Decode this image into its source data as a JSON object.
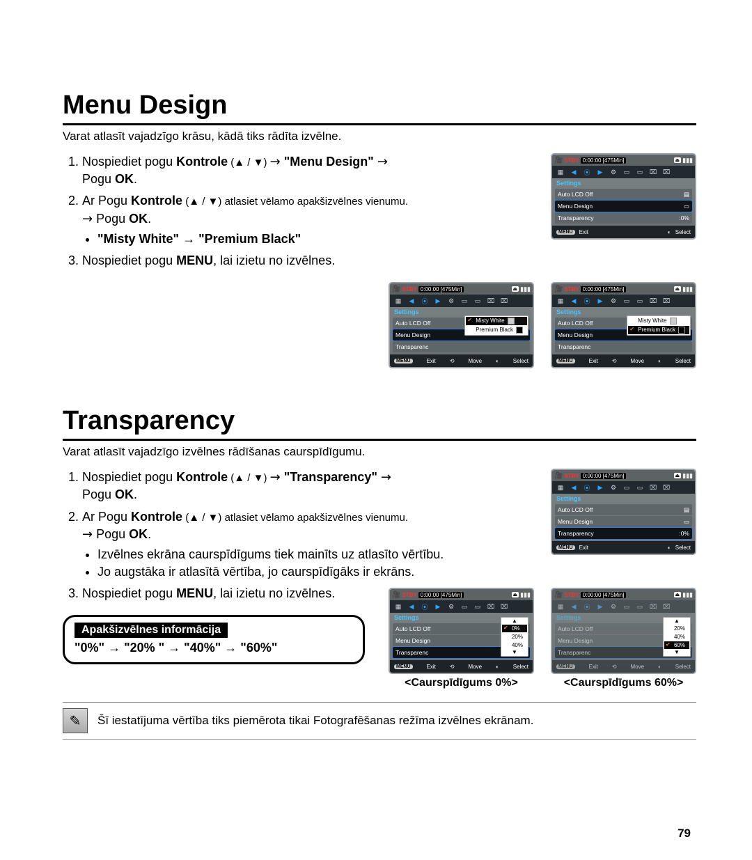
{
  "page_number": "79",
  "section1": {
    "title": "Menu Design",
    "intro": "Varat atlasīt vajadzīgo krāsu, kādā tiks rādīta izvēlne.",
    "step1_a": "Nospiediet pogu ",
    "step1_b": "Kontrole",
    "step1_c": " (▲ / ▼) ",
    "step1_arrow": "→",
    "step1_d": " \"Menu Design\" ",
    "step1_e": "Pogu ",
    "step1_f": "OK",
    "step2_a": "Ar Pogu ",
    "step2_b": "Kontrole",
    "step2_c": "  (▲ / ▼) atlasiet vēlamo apakšizvēlnes vienumu. ",
    "step2_arrow": "→",
    "step2_d": " Pogu ",
    "step2_e": "OK",
    "step2_bullet": "\"Misty White\" → \"Premium Black\"",
    "step3_a": "Nospiediet pogu ",
    "step3_b": "MENU",
    "step3_c": ", lai izietu no izvēlnes."
  },
  "section2": {
    "title": "Transparency",
    "intro": "Varat atlasīt vajadzīgo izvēlnes rādīšanas caurspīdīgumu.",
    "step1_a": "Nospiediet pogu ",
    "step1_b": "Kontrole",
    "step1_c": " (▲ / ▼) ",
    "step1_arrow": "→",
    "step1_d": " \"Transparency\" ",
    "step1_e": "Pogu ",
    "step1_f": "OK",
    "step2_a": "Ar Pogu ",
    "step2_b": "Kontrole",
    "step2_c": "  (▲ / ▼) atlasiet vēlamo apakšizvēlnes vienumu. ",
    "step2_arrow": "→",
    "step2_d": " Pogu ",
    "step2_e": "OK",
    "step2_bullet1": "Izvēlnes ekrāna caurspīdīgums tiek mainīts uz atlasīto vērtību.",
    "step2_bullet2": "Jo augstāka ir atlasītā vērtība, jo caurspīdīgāks ir ekrāns.",
    "step3_a": "Nospiediet pogu ",
    "step3_b": "MENU",
    "step3_c": ", lai izietu no izvēlnes.",
    "infobox_hdr": "Apakšizvēlnes informācija",
    "infobox_body": "\"0%\" → \"20% \" → \"40%\" → \"60%\"",
    "caption_left": "<Caurspīdīgums 0%>",
    "caption_right": "<Caurspīdīgums 60%>"
  },
  "note": "Šī iestatījuma vērtība tiks piemērota tikai Fotografēšanas režīma izvēlnes ekrānam.",
  "shot_common": {
    "stby": "STBY",
    "time": "0:00:00 [475Min]",
    "settings": "Settings",
    "exit_btn": "MENU",
    "exit": "Exit",
    "move": "Move",
    "select": "Select",
    "row1": "Auto LCD Off",
    "row2": "Menu Design",
    "row3": "Transparency",
    "val3": ":0%"
  },
  "popup_design": {
    "opt1": "Misty White",
    "opt2": "Premium Black"
  },
  "popup_trans": {
    "opt1": "0%",
    "opt2": "20%",
    "opt3": "40%",
    "opt4": "60%"
  }
}
